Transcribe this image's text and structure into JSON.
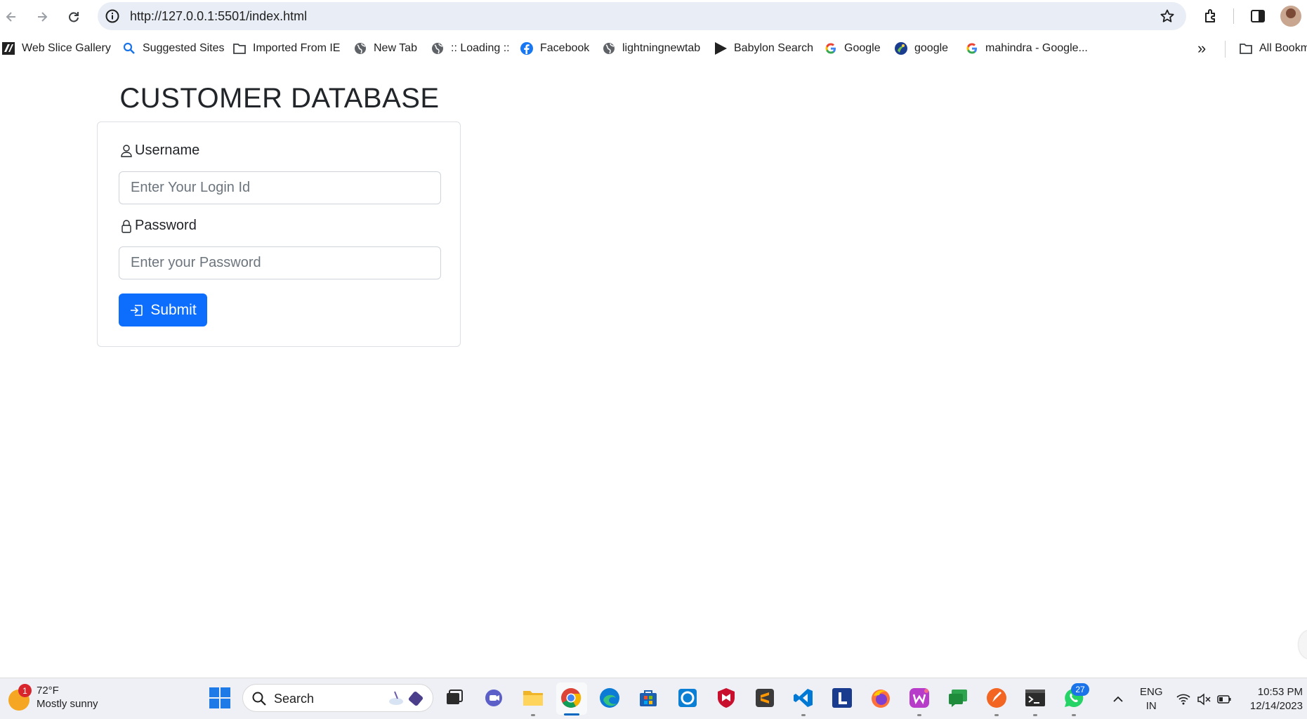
{
  "browser": {
    "url": "http://127.0.0.1:5501/index.html",
    "bookmarks": [
      {
        "label": "Web Slice Gallery",
        "icon": "web-slice-icon"
      },
      {
        "label": "Suggested Sites",
        "icon": "search-icon"
      },
      {
        "label": "Imported From IE",
        "icon": "folder-icon"
      },
      {
        "label": "New Tab",
        "icon": "globe-icon"
      },
      {
        "label": ":: Loading ::",
        "icon": "globe-icon"
      },
      {
        "label": "Facebook",
        "icon": "facebook-icon"
      },
      {
        "label": "lightningnewtab",
        "icon": "globe-icon"
      },
      {
        "label": "Babylon Search",
        "icon": "play-icon"
      },
      {
        "label": "Google",
        "icon": "google-icon"
      },
      {
        "label": "google",
        "icon": "google-earth-icon"
      },
      {
        "label": "mahindra - Google...",
        "icon": "google-icon"
      }
    ],
    "more_bookmarks": "»",
    "all_bookmarks": "All Bookm"
  },
  "page": {
    "title": "CUSTOMER DATABASE",
    "username_label": "Username",
    "username_placeholder": "Enter Your Login Id",
    "password_label": "Password",
    "password_placeholder": "Enter your Password",
    "submit_label": "Submit"
  },
  "taskbar": {
    "weather_temp": "72°F",
    "weather_desc": "Mostly sunny",
    "weather_badge": "1",
    "search_label": "Search",
    "whatsapp_badge": "27",
    "lang_1": "ENG",
    "lang_2": "IN",
    "time": "10:53 PM",
    "date": "12/14/2023"
  },
  "colors": {
    "accent": "#0d6efd",
    "omnibox": "#e9eef6",
    "taskbar": "#eef0f5"
  }
}
